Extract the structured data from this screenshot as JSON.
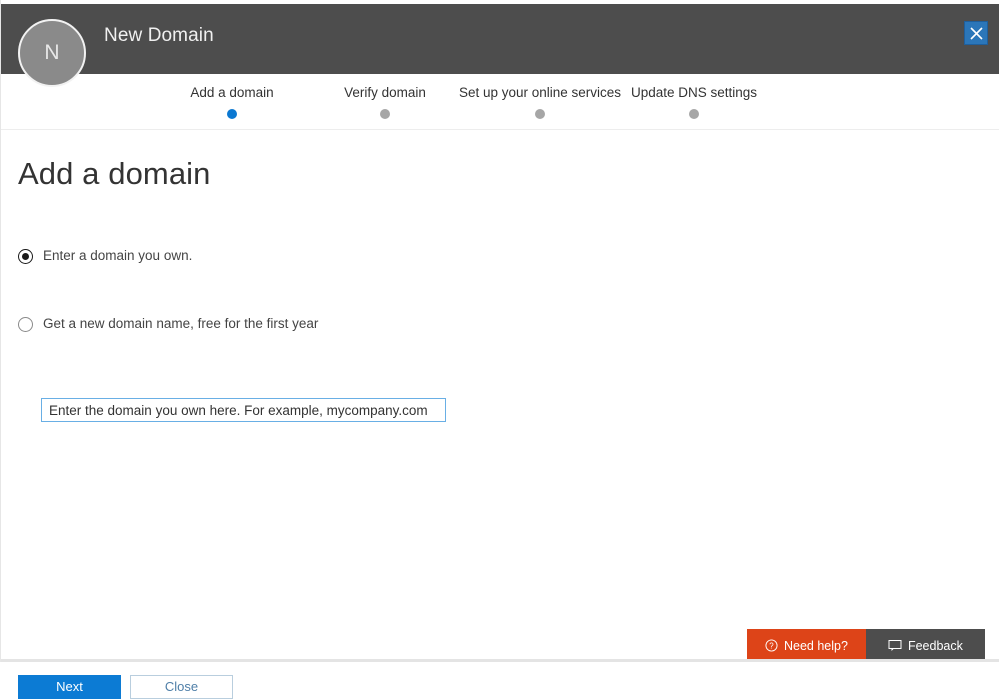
{
  "window": {
    "title": "New Domain",
    "avatar_initial": "N",
    "close_label": "Close",
    "close_icon": "close-icon"
  },
  "wizard": {
    "steps": [
      {
        "label": "Add a domain",
        "state": "active"
      },
      {
        "label": "Verify domain",
        "state": "inactive"
      },
      {
        "label": "Set up your online services",
        "state": "inactive"
      },
      {
        "label": "Update DNS settings",
        "state": "inactive"
      }
    ]
  },
  "main": {
    "heading": "Add a domain",
    "options": [
      {
        "label": "Enter a domain you own.",
        "selected": true
      },
      {
        "label": "Get a new domain name, free for the first year",
        "selected": false
      }
    ],
    "domain_input": {
      "value": "",
      "placeholder": "Enter the domain you own here. For example, mycompany.com"
    }
  },
  "actions": {
    "next_label": "Next",
    "close_label": "Close"
  },
  "footer": {
    "help_label": "Need help?",
    "help_icon": "question-circle-icon",
    "feedback_label": "Feedback",
    "feedback_icon": "comment-icon"
  },
  "colors": {
    "header_bg": "#4d4d4d",
    "accent_blue": "#0c7bd4",
    "step_active": "#0b78d1",
    "step_inactive": "#a6a6a6",
    "help_orange": "#dd4418",
    "input_border": "#69afe5"
  }
}
